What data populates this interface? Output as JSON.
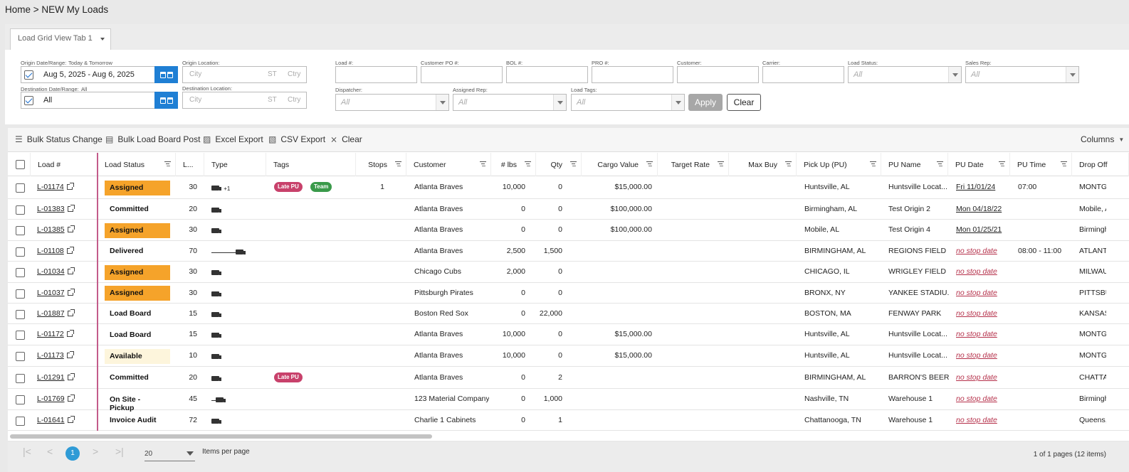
{
  "breadcrumb": "Home > NEW My Loads",
  "tab": {
    "label": "Load Grid View Tab 1"
  },
  "filters": {
    "origin_date_label": "Origin Date/Range:",
    "origin_date_hint": "Today & Tomorrow",
    "origin_date_value": "Aug 5, 2025 - Aug 6, 2025",
    "origin_location_label": "Origin Location:",
    "dest_date_label": "Destination Date/Range:",
    "dest_date_hint": "All",
    "dest_date_value": "All",
    "dest_location_label": "Destination Location:",
    "city_placeholder": "City",
    "st_placeholder": "ST",
    "ctry_placeholder": "Ctry",
    "load_label": "Load #:",
    "customer_po_label": "Customer PO #:",
    "bol_label": "BOL #:",
    "pro_label": "PRO #:",
    "customer_label": "Customer:",
    "carrier_label": "Carrier:",
    "load_status_label": "Load Status:",
    "sales_rep_label": "Sales Rep:",
    "dispatcher_label": "Dispatcher:",
    "assigned_rep_label": "Assigned Rep:",
    "load_tags_label": "Load Tags:",
    "all_placeholder": "All",
    "apply": "Apply",
    "clear": "Clear"
  },
  "toolbar": {
    "bulk_status": "Bulk Status Change",
    "bulk_board": "Bulk Load Board Post",
    "excel": "Excel Export",
    "csv": "CSV Export",
    "clear": "Clear",
    "columns": "Columns"
  },
  "columns": [
    "Load #",
    "Load Status",
    "L...",
    "Type",
    "Tags",
    "Stops",
    "Customer",
    "# lbs",
    "Qty",
    "Cargo Value",
    "Target Rate",
    "Max Buy",
    "Pick Up (PU)",
    "PU Name",
    "PU Date",
    "PU Time",
    "Drop Off"
  ],
  "status_colors": {
    "Assigned": "#f5a32a",
    "Available": "#fdf5dc"
  },
  "tag_colors": {
    "Late PU": "#c8416b",
    "Team": "#3a9a4a"
  },
  "rows": [
    {
      "load": "L-01174",
      "status": "Assigned",
      "l": "30",
      "type": "truck+1",
      "tags": [
        "Late PU",
        "Team"
      ],
      "stops": "1",
      "customer": "Atlanta Braves",
      "lbs": "10,000",
      "qty": "0",
      "cargo": "$15,000.00",
      "pu": "Huntsville, AL",
      "pu_name": "Huntsville Locat...",
      "pu_date": "Fri 11/01/24",
      "pu_date_type": "date",
      "pu_time": "07:00",
      "drop": "MONTGOMERY"
    },
    {
      "load": "L-01383",
      "status": "Committed",
      "l": "20",
      "type": "truck",
      "tags": [],
      "stops": "",
      "customer": "Atlanta Braves",
      "lbs": "0",
      "qty": "0",
      "cargo": "$100,000.00",
      "pu": "Birmingham, AL",
      "pu_name": "Test Origin 2",
      "pu_date": "Mon 04/18/22",
      "pu_date_type": "date",
      "pu_time": "",
      "drop": "Mobile, AL"
    },
    {
      "load": "L-01385",
      "status": "Assigned",
      "l": "30",
      "type": "truck",
      "tags": [],
      "stops": "",
      "customer": "Atlanta Braves",
      "lbs": "0",
      "qty": "0",
      "cargo": "$100,000.00",
      "pu": "Mobile, AL",
      "pu_name": "Test Origin 4",
      "pu_date": "Mon 01/25/21",
      "pu_date_type": "date",
      "pu_time": "",
      "drop": "Birmingham"
    },
    {
      "load": "L-01108",
      "status": "Delivered",
      "l": "70",
      "type": "line",
      "tags": [],
      "stops": "",
      "customer": "Atlanta Braves",
      "lbs": "2,500",
      "qty": "1,500",
      "cargo": "",
      "pu": "BIRMINGHAM, AL",
      "pu_name": "REGIONS FIELD",
      "pu_date": "no stop date",
      "pu_date_type": "none",
      "pu_time": "08:00 - 11:00",
      "drop": "ATLANTA"
    },
    {
      "load": "L-01034",
      "status": "Assigned",
      "l": "30",
      "type": "truck",
      "tags": [],
      "stops": "",
      "customer": "Chicago Cubs",
      "lbs": "2,000",
      "qty": "0",
      "cargo": "",
      "pu": "CHICAGO, IL",
      "pu_name": "WRIGLEY FIELD",
      "pu_date": "no stop date",
      "pu_date_type": "none",
      "pu_time": "",
      "drop": "MILWAUKEE"
    },
    {
      "load": "L-01037",
      "status": "Assigned",
      "l": "30",
      "type": "truck",
      "tags": [],
      "stops": "",
      "customer": "Pittsburgh Pirates",
      "lbs": "0",
      "qty": "0",
      "cargo": "",
      "pu": "BRONX, NY",
      "pu_name": "YANKEE STADIU...",
      "pu_date": "no stop date",
      "pu_date_type": "none",
      "pu_time": "",
      "drop": "PITTSBURGH"
    },
    {
      "load": "L-01887",
      "status": "Load Board",
      "l": "15",
      "type": "truck",
      "tags": [],
      "stops": "",
      "customer": "Boston Red Sox",
      "lbs": "0",
      "qty": "22,000",
      "cargo": "",
      "pu": "BOSTON, MA",
      "pu_name": "FENWAY PARK",
      "pu_date": "no stop date",
      "pu_date_type": "none",
      "pu_time": "",
      "drop": "KANSAS CITY"
    },
    {
      "load": "L-01172",
      "status": "Load Board",
      "l": "15",
      "type": "truck",
      "tags": [],
      "stops": "",
      "customer": "Atlanta Braves",
      "lbs": "10,000",
      "qty": "0",
      "cargo": "$15,000.00",
      "pu": "Huntsville, AL",
      "pu_name": "Huntsville Locat...",
      "pu_date": "no stop date",
      "pu_date_type": "none",
      "pu_time": "",
      "drop": "MONTGOMERY"
    },
    {
      "load": "L-01173",
      "status": "Available",
      "l": "10",
      "type": "truck",
      "tags": [],
      "stops": "",
      "customer": "Atlanta Braves",
      "lbs": "10,000",
      "qty": "0",
      "cargo": "$15,000.00",
      "pu": "Huntsville, AL",
      "pu_name": "Huntsville Locat...",
      "pu_date": "no stop date",
      "pu_date_type": "none",
      "pu_time": "",
      "drop": "MONTGOMERY"
    },
    {
      "load": "L-01291",
      "status": "Committed",
      "l": "20",
      "type": "truck",
      "tags": [
        "Late PU"
      ],
      "stops": "",
      "customer": "Atlanta Braves",
      "lbs": "0",
      "qty": "2",
      "cargo": "",
      "pu": "BIRMINGHAM, AL",
      "pu_name": "BARRON'S BEERS",
      "pu_date": "no stop date",
      "pu_date_type": "none",
      "pu_time": "",
      "drop": "CHATTANOOGA"
    },
    {
      "load": "L-01769",
      "status": "On Site - Pickup",
      "l": "45",
      "type": "line-short",
      "tags": [],
      "stops": "",
      "customer": "123 Material Company",
      "lbs": "0",
      "qty": "1,000",
      "cargo": "",
      "pu": "Nashville, TN",
      "pu_name": "Warehouse 1",
      "pu_date": "no stop date",
      "pu_date_type": "none",
      "pu_time": "",
      "drop": "Birmingham"
    },
    {
      "load": "L-01641",
      "status": "Invoice Audit",
      "l": "72",
      "type": "truck",
      "tags": [],
      "stops": "",
      "customer": "Charlie 1 Cabinets",
      "lbs": "0",
      "qty": "1",
      "cargo": "",
      "pu": "Chattanooga, TN",
      "pu_name": "Warehouse 1",
      "pu_date": "no stop date",
      "pu_date_type": "none",
      "pu_time": "",
      "drop": "Queens, NY"
    }
  ],
  "pager": {
    "current": "1",
    "per_page": "20",
    "per_page_label": "Items per page",
    "summary": "1 of 1 pages (12 items)"
  }
}
